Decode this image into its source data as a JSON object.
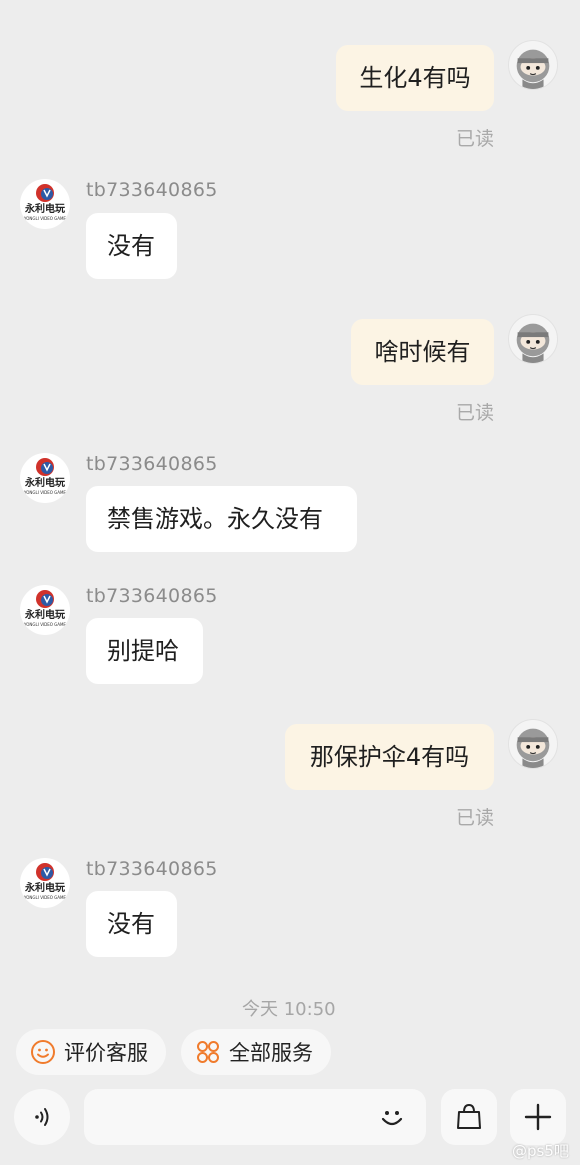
{
  "shop": {
    "name": "tb733640865",
    "logo_text": "永利电玩",
    "logo_sub": "YONGLI VIDEO GAME",
    "accent": "#d0322b",
    "logo_blue": "#2d5aa6"
  },
  "messages": [
    {
      "from": "me",
      "text": "生化4有吗",
      "status": "已读"
    },
    {
      "from": "shop",
      "sender": "tb733640865",
      "text": "没有"
    },
    {
      "from": "me",
      "text": "啥时候有",
      "status": "已读"
    },
    {
      "from": "shop",
      "sender": "tb733640865",
      "text": "禁售游戏。永久没有"
    },
    {
      "from": "shop",
      "sender": "tb733640865",
      "text": "别提哈"
    },
    {
      "from": "me",
      "text": "那保护伞4有吗",
      "status": "已读"
    },
    {
      "from": "shop",
      "sender": "tb733640865",
      "text": "没有"
    }
  ],
  "timestamp": "今天 10:50",
  "quick_actions": [
    {
      "label": "评价客服",
      "icon": "smiley-icon",
      "color": "#f07b2c"
    },
    {
      "label": "全部服务",
      "icon": "grid-icon",
      "color": "#f07b2c"
    }
  ],
  "input": {
    "value": "",
    "placeholder": ""
  },
  "toolbar": {
    "voice_icon": "voice-icon",
    "emoji_icon": "emoji-icon",
    "bag_icon": "shopping-bag-icon",
    "plus_icon": "plus-icon"
  },
  "watermark": "@ps5吧"
}
